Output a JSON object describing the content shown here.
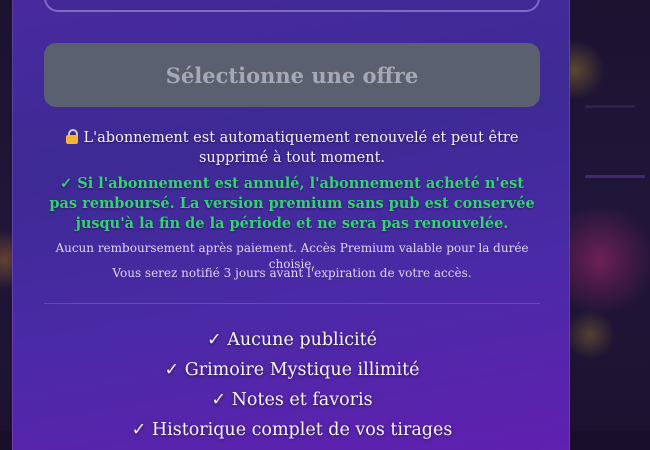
{
  "subscription_modal": {
    "select_offer_label": "Sélectionne une offre",
    "auto_renew_text": "L'abonnement est automatiquement renouvelé et peut être supprimé à tout moment.",
    "cancel_notice": "✓ Si l'abonnement est annulé, l'abonnement acheté n'est pas remboursé. La version premium sans pub est conservée jusqu'à la fin de la période et ne sera pas renouvelée.",
    "refund_notice": "Aucun remboursement après paiement. Accès Premium valable pour la durée choisie.",
    "expiry_notice": "Vous serez notifié 3 jours avant l'expiration de votre accès.",
    "features": [
      "✓ Aucune publicité",
      "✓ Grimoire Mystique illimité",
      "✓ Notes et favoris",
      "✓ Historique complet de vos tirages"
    ]
  },
  "icons": {
    "auto_renew": "lock-icon"
  },
  "colors": {
    "cta_background": "#5b6070",
    "cta_text": "#a6a9b3",
    "success_text": "#34d176",
    "modal_gradient_start": "#4a2aa0",
    "modal_gradient_end": "#6020b0"
  }
}
